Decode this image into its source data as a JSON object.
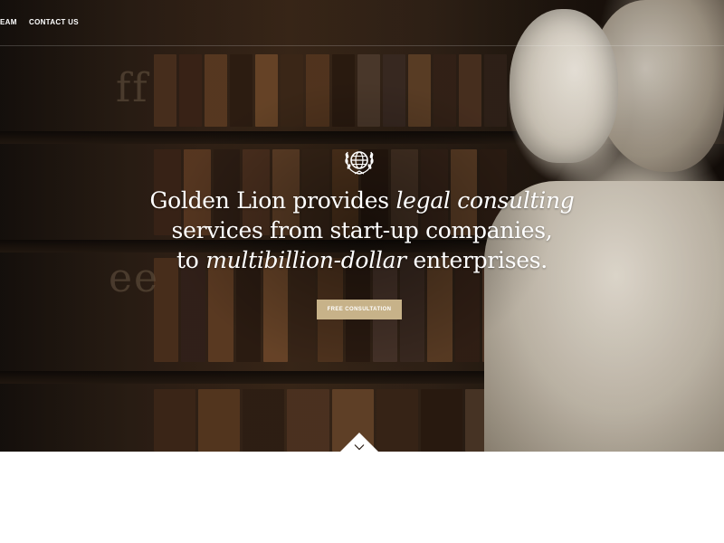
{
  "nav": {
    "items": [
      {
        "label": "EAM"
      },
      {
        "label": "CONTACT US"
      }
    ]
  },
  "hero": {
    "crest_icon": "laurel-globe-icon",
    "headline": {
      "part1": "Golden Lion provides ",
      "part2_italic": "legal consulting",
      "part3": "services from start-up companies,",
      "part4": "to ",
      "part5_italic": "multibillion-dollar",
      "part6": " enterprises."
    },
    "cta_label": "FREE CONSULTATION",
    "scroll_icon": "chevron-down-icon"
  },
  "colors": {
    "accent": "#c7b289",
    "hero_dark": "#2a1d14",
    "text_light": "#ffffff"
  }
}
